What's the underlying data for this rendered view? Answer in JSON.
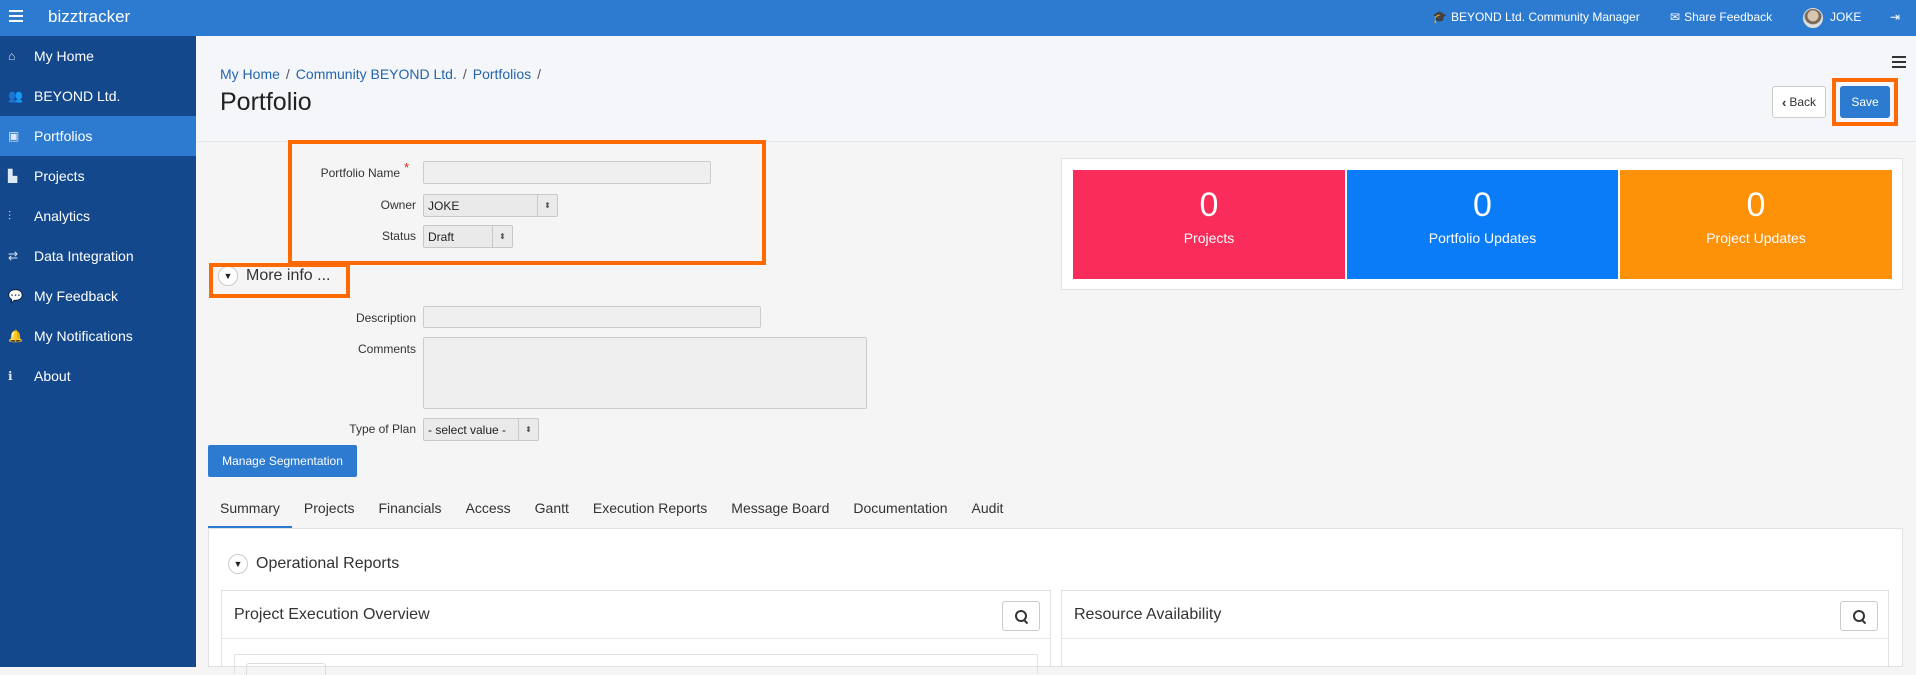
{
  "topbar": {
    "brand": "bizztracker",
    "community_manager": "BEYOND Ltd. Community Manager",
    "share_feedback": "Share Feedback",
    "user": "JOKE"
  },
  "sidebar": {
    "items": [
      {
        "label": "My Home",
        "icon": "home-icon"
      },
      {
        "label": "BEYOND Ltd.",
        "icon": "users-icon"
      },
      {
        "label": "Portfolios",
        "icon": "briefcase-icon"
      },
      {
        "label": "Projects",
        "icon": "bar-chart-icon"
      },
      {
        "label": "Analytics",
        "icon": "line-chart-icon"
      },
      {
        "label": "Data Integration",
        "icon": "exchange-icon"
      },
      {
        "label": "My Feedback",
        "icon": "comments-icon"
      },
      {
        "label": "My Notifications",
        "icon": "bell-icon"
      },
      {
        "label": "About",
        "icon": "info-icon"
      }
    ],
    "active_index": 2
  },
  "header": {
    "breadcrumb": [
      "My Home",
      "Community BEYOND Ltd.",
      "Portfolios"
    ],
    "title": "Portfolio",
    "back_label": "Back",
    "save_label": "Save"
  },
  "form": {
    "portfolio_name_label": "Portfolio Name",
    "portfolio_name_value": "",
    "required_mark": "*",
    "owner_label": "Owner",
    "owner_value": "JOKE",
    "status_label": "Status",
    "status_value": "Draft",
    "more_info_label": "More info ...",
    "description_label": "Description",
    "comments_label": "Comments",
    "type_of_plan_label": "Type of Plan",
    "type_of_plan_value": "- select value -",
    "manage_segmentation_label": "Manage Segmentation"
  },
  "stats": [
    {
      "value": "0",
      "label": "Projects",
      "color": "#fa2d5a"
    },
    {
      "value": "0",
      "label": "Portfolio Updates",
      "color": "#0a7cf8"
    },
    {
      "value": "0",
      "label": "Project Updates",
      "color": "#fd9108"
    }
  ],
  "tabs": [
    "Summary",
    "Projects",
    "Financials",
    "Access",
    "Gantt",
    "Execution Reports",
    "Message Board",
    "Documentation",
    "Audit"
  ],
  "active_tab": "Summary",
  "summary": {
    "section_title": "Operational Reports",
    "card_left_title": "Project Execution Overview",
    "card_right_title": "Resource Availability"
  },
  "colors": {
    "accent": "#2c7bd0",
    "sidebar": "#13488d",
    "highlight": "#ff6a00"
  }
}
